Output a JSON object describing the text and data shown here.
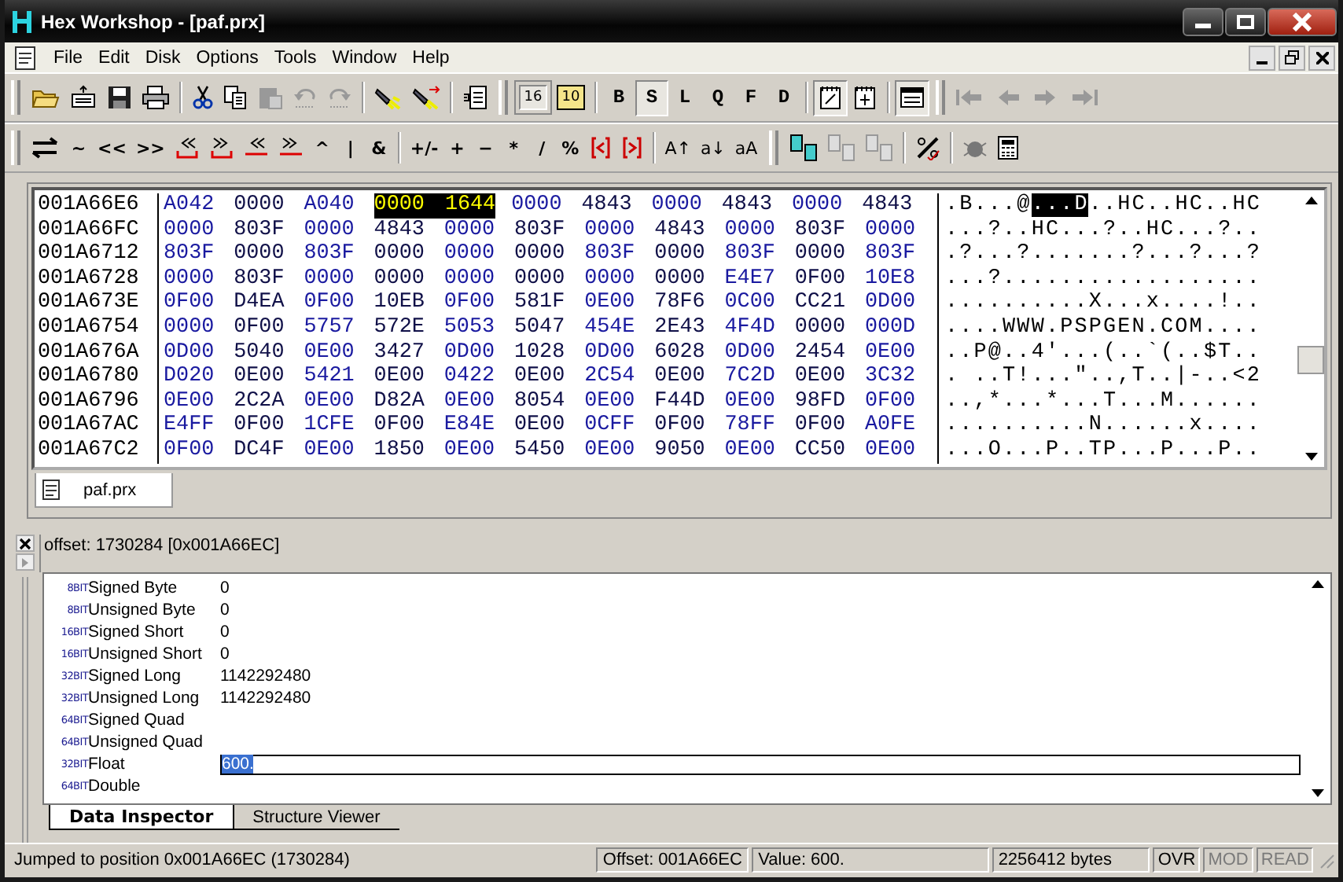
{
  "window": {
    "title": "Hex Workshop - [paf.prx]"
  },
  "menu": [
    "File",
    "Edit",
    "Disk",
    "Options",
    "Tools",
    "Window",
    "Help"
  ],
  "toolbar_1": {
    "edit_buttons": [
      {
        "disabled": false
      },
      {
        "disabled": false
      },
      {
        "disabled": true
      },
      {
        "disabled": true
      },
      {
        "disabled": true
      }
    ],
    "number_bases": [
      {
        "label": "16",
        "selected": true
      },
      {
        "label": "10",
        "selected": false
      }
    ],
    "base_types": [
      {
        "label": "B",
        "selected": false
      },
      {
        "label": "S",
        "selected": true
      },
      {
        "label": "L",
        "selected": false
      },
      {
        "label": "Q",
        "selected": false
      },
      {
        "label": "F",
        "selected": false
      },
      {
        "label": "D",
        "selected": false
      }
    ],
    "view_toggles": [
      {
        "selected": true
      },
      {
        "selected": false
      },
      {
        "selected": true
      }
    ],
    "nav_buttons": [
      {
        "disabled": true
      },
      {
        "disabled": true
      },
      {
        "disabled": true
      },
      {
        "disabled": true
      }
    ]
  },
  "toolbar_2": {
    "bitwise_ops": [
      "~",
      "<<",
      ">>"
    ],
    "logic_ops": [
      "^",
      "|",
      "&"
    ],
    "arith_ops": [
      "+/-",
      "+",
      "−",
      "*",
      "/",
      "%"
    ],
    "case_ops": [
      "A↑",
      "a↓",
      "aA"
    ],
    "compare_buttons": [
      {
        "disabled": false
      },
      {
        "disabled": true
      },
      {
        "disabled": true
      }
    ]
  },
  "hex_view": {
    "rows": [
      {
        "address": "001A66E6",
        "word_groups": [
          {
            "words": [
              "A042",
              "0000",
              "A040"
            ],
            "selected": false
          },
          {
            "words": [
              "0000",
              "1644"
            ],
            "selected": true
          },
          {
            "words": [
              "0000",
              "4843",
              "0000",
              "4843",
              "0000",
              "4843"
            ],
            "selected": false
          }
        ],
        "ascii": [
          {
            "text": ".B...@",
            "selected": false
          },
          {
            "text": "...D",
            "selected": true
          },
          {
            "text": "..HC..HC..HC",
            "selected": false
          }
        ]
      },
      {
        "address": "001A66FC",
        "word_groups": [
          {
            "words": [
              "0000",
              "803F",
              "0000",
              "4843",
              "0000",
              "803F",
              "0000",
              "4843",
              "0000",
              "803F",
              "0000"
            ],
            "selected": false
          }
        ],
        "ascii": [
          {
            "text": "...?..HC...?..HC...?..",
            "selected": false
          }
        ]
      },
      {
        "address": "001A6712",
        "word_groups": [
          {
            "words": [
              "803F",
              "0000",
              "803F",
              "0000",
              "0000",
              "0000",
              "803F",
              "0000",
              "803F",
              "0000",
              "803F"
            ],
            "selected": false
          }
        ],
        "ascii": [
          {
            "text": ".?...?.......?...?...?",
            "selected": false
          }
        ]
      },
      {
        "address": "001A6728",
        "word_groups": [
          {
            "words": [
              "0000",
              "803F",
              "0000",
              "0000",
              "0000",
              "0000",
              "0000",
              "0000",
              "E4E7",
              "0F00",
              "10E8"
            ],
            "selected": false
          }
        ],
        "ascii": [
          {
            "text": "...?..................",
            "selected": false
          }
        ]
      },
      {
        "address": "001A673E",
        "word_groups": [
          {
            "words": [
              "0F00",
              "D4EA",
              "0F00",
              "10EB",
              "0F00",
              "581F",
              "0E00",
              "78F6",
              "0C00",
              "CC21",
              "0D00"
            ],
            "selected": false
          }
        ],
        "ascii": [
          {
            "text": "..........X...x....!..",
            "selected": false
          }
        ]
      },
      {
        "address": "001A6754",
        "word_groups": [
          {
            "words": [
              "0000",
              "0F00",
              "5757",
              "572E",
              "5053",
              "5047",
              "454E",
              "2E43",
              "4F4D",
              "0000",
              "000D"
            ],
            "selected": false
          }
        ],
        "ascii": [
          {
            "text": "....WWW.PSPGEN.COM....",
            "selected": false
          }
        ]
      },
      {
        "address": "001A676A",
        "word_groups": [
          {
            "words": [
              "0D00",
              "5040",
              "0E00",
              "3427",
              "0D00",
              "1028",
              "0D00",
              "6028",
              "0D00",
              "2454",
              "0E00"
            ],
            "selected": false
          }
        ],
        "ascii": [
          {
            "text": "..P@..4'...(..`(..$T..",
            "selected": false
          }
        ]
      },
      {
        "address": "001A6780",
        "word_groups": [
          {
            "words": [
              "D020",
              "0E00",
              "5421",
              "0E00",
              "0422",
              "0E00",
              "2C54",
              "0E00",
              "7C2D",
              "0E00",
              "3C32"
            ],
            "selected": false
          }
        ],
        "ascii": [
          {
            "text": ". ..T!...\"..,T..|-..<2",
            "selected": false
          }
        ]
      },
      {
        "address": "001A6796",
        "word_groups": [
          {
            "words": [
              "0E00",
              "2C2A",
              "0E00",
              "D82A",
              "0E00",
              "8054",
              "0E00",
              "F44D",
              "0E00",
              "98FD",
              "0F00"
            ],
            "selected": false
          }
        ],
        "ascii": [
          {
            "text": "..,*...*...T...M......",
            "selected": false
          }
        ]
      },
      {
        "address": "001A67AC",
        "word_groups": [
          {
            "words": [
              "E4FF",
              "0F00",
              "1CFE",
              "0F00",
              "E84E",
              "0E00",
              "0CFF",
              "0F00",
              "78FF",
              "0F00",
              "A0FE"
            ],
            "selected": false
          }
        ],
        "ascii": [
          {
            "text": "..........N......x....",
            "selected": false
          }
        ]
      },
      {
        "address": "001A67C2",
        "word_groups": [
          {
            "words": [
              "0F00",
              "DC4F",
              "0E00",
              "1850",
              "0E00",
              "5450",
              "0E00",
              "9050",
              "0E00",
              "CC50",
              "0E00"
            ],
            "selected": false
          }
        ],
        "ascii": [
          {
            "text": "...O...P..TP...P...P..",
            "selected": false
          }
        ]
      }
    ]
  },
  "document_tabs": [
    {
      "label": "paf.prx",
      "selected": true
    }
  ],
  "inspector": {
    "offset": "offset: 1730284 [0x001A66EC]",
    "rows": [
      {
        "bits": "8BIT",
        "label": "Signed Byte",
        "value": "0"
      },
      {
        "bits": "8BIT",
        "label": "Unsigned Byte",
        "value": "0"
      },
      {
        "bits": "16BIT",
        "label": "Signed Short",
        "value": "0"
      },
      {
        "bits": "16BIT",
        "label": "Unsigned Short",
        "value": "0"
      },
      {
        "bits": "32BIT",
        "label": "Signed Long",
        "value": "1142292480"
      },
      {
        "bits": "32BIT",
        "label": "Unsigned Long",
        "value": "1142292480"
      },
      {
        "bits": "64BIT",
        "label": "Signed Quad"
      },
      {
        "bits": "64BIT",
        "label": "Unsigned Quad"
      },
      {
        "bits": "32BIT",
        "label": "Float",
        "value": "600.",
        "editing": true
      },
      {
        "bits": "64BIT",
        "label": "Double"
      }
    ],
    "tabs": [
      {
        "label": "Data Inspector",
        "selected": true
      },
      {
        "label": "Structure Viewer",
        "selected": false
      }
    ]
  },
  "status_bar": {
    "message": "Jumped to position 0x001A66EC (1730284)",
    "offset": "Offset: 001A66EC",
    "value": "Value: 600.",
    "size": "2256412 bytes",
    "indicators": [
      {
        "label": "OVR",
        "disabled": false
      },
      {
        "label": "MOD",
        "disabled": true
      },
      {
        "label": "READ",
        "disabled": true
      }
    ]
  }
}
